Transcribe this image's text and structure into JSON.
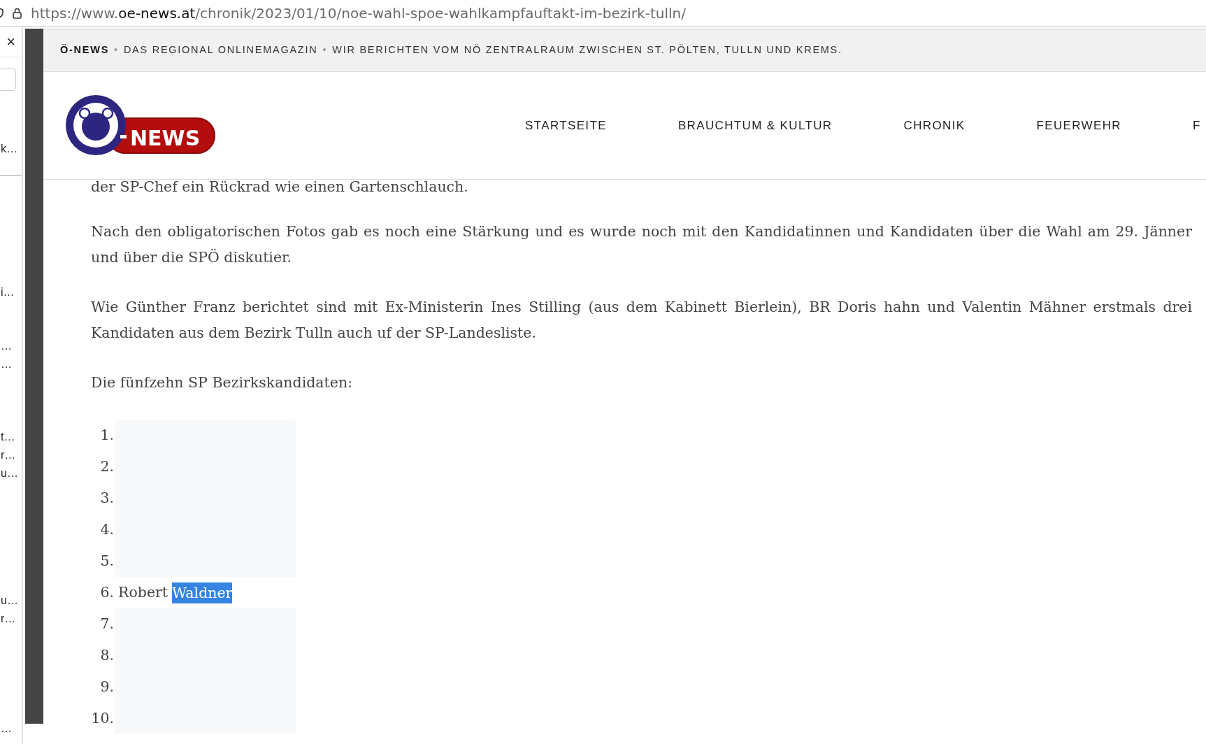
{
  "address_bar": {
    "prefix": "https://www.",
    "domain": "oe-news.at",
    "path": "/chronik/2023/01/10/noe-wahl-spoe-wahlkampfauftakt-im-bezirk-tulln/"
  },
  "side_panel": {
    "close": "×",
    "snippets": [
      "k…",
      "i…",
      "…",
      "…",
      "t…",
      "r…",
      "u…",
      "u…",
      "r…",
      "…"
    ]
  },
  "top_strip": {
    "brand": "Ö-NEWS",
    "separator": "•",
    "tagline": "DAS REGIONAL ONLINEMAGAZIN",
    "about": "WIR BERICHTEN VOM NÖ ZENTRALRAUM ZWISCHEN ST. PÖLTEN, TULLN UND KREMS."
  },
  "logo": {
    "text": "NEWS"
  },
  "nav": [
    "STARTSEITE",
    "BRAUCHTUM & KULTUR",
    "CHRONIK",
    "FEUERWEHR",
    "F"
  ],
  "article": {
    "paragraphs": [
      "der SP-Chef ein Rückrad wie einen Gartenschlauch.",
      "Nach den obligatorischen Fotos gab es noch eine Stärkung und es wurde noch mit den Kandidatinnen und Kandidaten über die Wahl am 29. Jänner und über die SPÖ diskutier.",
      "Wie Günther Franz berichtet sind mit Ex-Ministerin Ines Stilling (aus dem Kabinett Bierlein), BR Doris hahn und Valentin Mähner erstmals drei Kandidaten aus dem Bezirk Tulln auch uf der SP-Landesliste.",
      "Die fünfzehn SP Bezirkskandidaten:"
    ],
    "list": [
      {
        "number": "1.",
        "kind": "redacted"
      },
      {
        "number": "2.",
        "kind": "redacted"
      },
      {
        "number": "3.",
        "kind": "redacted"
      },
      {
        "number": "4.",
        "kind": "redacted"
      },
      {
        "number": "5.",
        "kind": "redacted"
      },
      {
        "number": "6.",
        "kind": "name",
        "text": "Robert",
        "highlighted_text": "Waldner"
      },
      {
        "number": "7.",
        "kind": "redacted"
      },
      {
        "number": "8.",
        "kind": "redacted"
      },
      {
        "number": "9.",
        "kind": "redacted"
      },
      {
        "number": "10.",
        "kind": "redacted"
      }
    ]
  }
}
